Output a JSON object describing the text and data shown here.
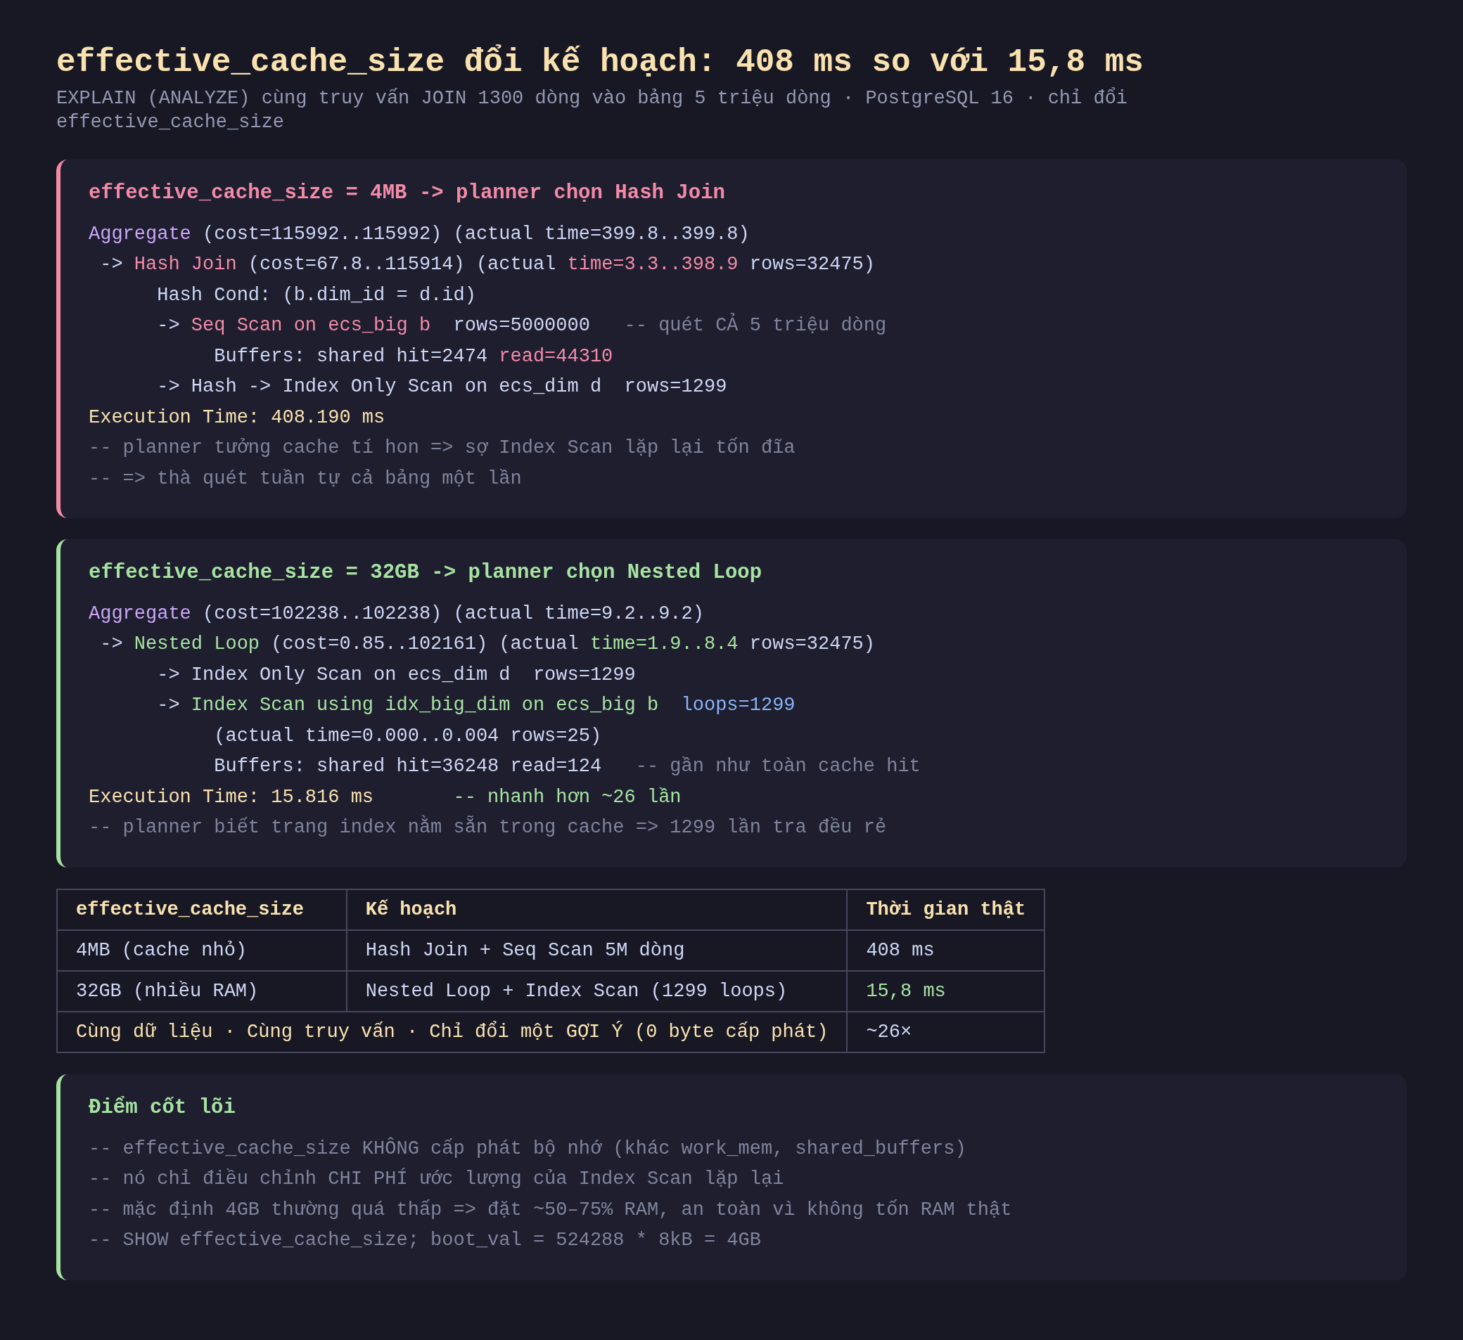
{
  "header": {
    "title": "effective_cache_size đổi kế hoạch: 408 ms so với 15,8 ms",
    "subtitle": "EXPLAIN (ANALYZE) cùng truy vấn JOIN 1300 dòng vào bảng 5 triệu dòng · PostgreSQL 16 · chỉ đổi effective_cache_size"
  },
  "plans": [
    {
      "kind": "bad",
      "heading": "effective_cache_size = 4MB -> planner chọn Hash Join",
      "lines": [
        [
          {
            "text": "Aggregate",
            "kind": "node"
          },
          {
            "text": " (cost=115992..115992) (actual time=399.8..399.8)",
            "kind": "plain"
          }
        ],
        [
          {
            "text": " -> ",
            "kind": "plain"
          },
          {
            "text": "Hash Join",
            "kind": "bad"
          },
          {
            "text": " (cost=67.8..115914) (actual ",
            "kind": "plain"
          },
          {
            "text": "time=3.3..398.9",
            "kind": "bad"
          },
          {
            "text": " rows=32475)",
            "kind": "plain"
          }
        ],
        [
          {
            "text": "      Hash Cond: (b.dim_id = d.id)",
            "kind": "plain"
          }
        ],
        [
          {
            "text": "      -> ",
            "kind": "plain"
          },
          {
            "text": "Seq Scan on ecs_big b",
            "kind": "bad"
          },
          {
            "text": "  rows=5000000   ",
            "kind": "plain"
          },
          {
            "text": "-- quét CẢ 5 triệu dòng",
            "kind": "comment"
          }
        ],
        [
          {
            "text": "           Buffers: shared hit=2474 ",
            "kind": "plain"
          },
          {
            "text": "read=44310",
            "kind": "bad"
          }
        ],
        [
          {
            "text": "      -> Hash -> Index Only Scan on ecs_dim d  rows=1299",
            "kind": "plain"
          }
        ],
        [
          {
            "text": "Execution Time: 408.190 ms",
            "kind": "time"
          }
        ],
        [
          {
            "text": "-- planner tưởng cache tí hon => sợ Index Scan lặp lại tốn đĩa",
            "kind": "comment"
          }
        ],
        [
          {
            "text": "-- => thà quét tuần tự cả bảng một lần",
            "kind": "comment"
          }
        ]
      ]
    },
    {
      "kind": "good",
      "heading": "effective_cache_size = 32GB -> planner chọn Nested Loop",
      "lines": [
        [
          {
            "text": "Aggregate",
            "kind": "node"
          },
          {
            "text": " (cost=102238..102238) (actual time=9.2..9.2)",
            "kind": "plain"
          }
        ],
        [
          {
            "text": " -> ",
            "kind": "plain"
          },
          {
            "text": "Nested Loop",
            "kind": "good"
          },
          {
            "text": " (cost=0.85..102161) (actual ",
            "kind": "plain"
          },
          {
            "text": "time=1.9..8.4",
            "kind": "good"
          },
          {
            "text": " rows=32475)",
            "kind": "plain"
          }
        ],
        [
          {
            "text": "      -> Index Only Scan on ecs_dim d  rows=1299",
            "kind": "plain"
          }
        ],
        [
          {
            "text": "      -> ",
            "kind": "plain"
          },
          {
            "text": "Index Scan using idx_big_dim on ecs_big b",
            "kind": "good"
          },
          {
            "text": "  loops=1299",
            "kind": "info"
          }
        ],
        [
          {
            "text": "           (actual time=0.000..0.004 rows=25)",
            "kind": "plain"
          }
        ],
        [
          {
            "text": "           Buffers: shared hit=36248 read=124   ",
            "kind": "plain"
          },
          {
            "text": "-- gần như toàn cache hit",
            "kind": "comment"
          }
        ],
        [
          {
            "text": "Execution Time: 15.816 ms       ",
            "kind": "time"
          },
          {
            "text": "-- nhanh hơn ~26 lần",
            "kind": "good"
          }
        ],
        [
          {
            "text": "-- planner biết trang index nằm sẵn trong cache => 1299 lần tra đều rẻ",
            "kind": "comment"
          }
        ]
      ]
    }
  ],
  "table": {
    "columns": [
      "effective_cache_size",
      "Kế hoạch",
      "Thời gian thật"
    ],
    "rows": [
      {
        "cells": [
          "4MB (cache nhỏ)",
          "Hash Join + Seq Scan 5M dòng",
          "408 ms"
        ],
        "highlight": false
      },
      {
        "cells": [
          "32GB (nhiều RAM)",
          "Nested Loop + Index Scan (1299 loops)",
          "15,8 ms"
        ],
        "highlight": true
      }
    ],
    "footer": {
      "note": "Cùng dữ liệu · Cùng truy vấn · Chỉ đổi một GỢI Ý (0 byte cấp phát)",
      "ratio": "~26×"
    }
  },
  "key_points": {
    "kind": "good",
    "heading": "Điểm cốt lõi",
    "lines": [
      "-- effective_cache_size KHÔNG cấp phát bộ nhớ (khác work_mem, shared_buffers)",
      "-- nó chỉ điều chỉnh CHI PHÍ ước lượng của Index Scan lặp lại",
      "-- mặc định 4GB thường quá thấp => đặt ~50–75% RAM, an toàn vì không tốn RAM thật",
      "-- SHOW effective_cache_size; boot_val = 524288 * 8kB = 4GB"
    ]
  }
}
